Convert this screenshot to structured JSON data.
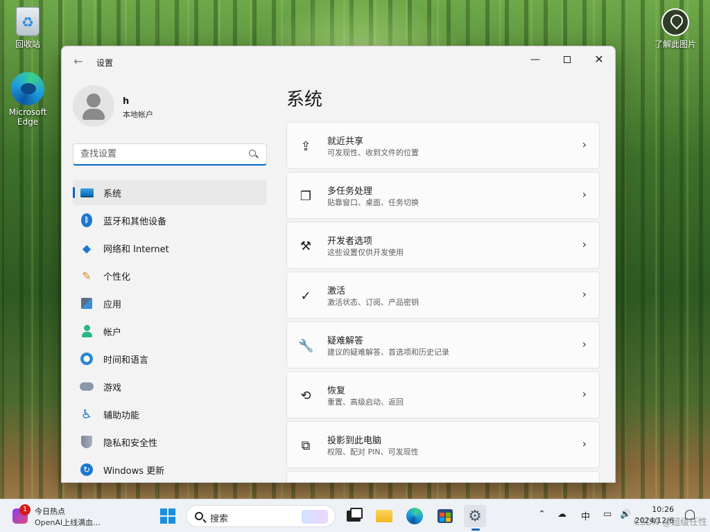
{
  "desktop": {
    "icons": [
      {
        "label": "回收站",
        "icon": "recycle-bin-icon"
      },
      {
        "label": "Microsoft Edge",
        "icon": "edge-icon"
      },
      {
        "label": "了解此图片",
        "icon": "learn-about-picture-icon"
      }
    ]
  },
  "window": {
    "title": "设置",
    "user": {
      "name": "h",
      "account_type": "本地帐户"
    },
    "search": {
      "placeholder": "查找设置"
    },
    "nav": [
      {
        "label": "系统",
        "icon": "system-icon",
        "active": true
      },
      {
        "label": "蓝牙和其他设备",
        "icon": "bluetooth-icon"
      },
      {
        "label": "网络和 Internet",
        "icon": "wifi-icon"
      },
      {
        "label": "个性化",
        "icon": "brush-icon"
      },
      {
        "label": "应用",
        "icon": "apps-icon"
      },
      {
        "label": "帐户",
        "icon": "account-icon"
      },
      {
        "label": "时间和语言",
        "icon": "time-language-icon"
      },
      {
        "label": "游戏",
        "icon": "gamepad-icon"
      },
      {
        "label": "辅助功能",
        "icon": "accessibility-icon"
      },
      {
        "label": "隐私和安全性",
        "icon": "shield-icon"
      },
      {
        "label": "Windows 更新",
        "icon": "update-icon"
      }
    ],
    "page_title": "系统",
    "cards": [
      {
        "title": "就近共享",
        "subtitle": "可发现性、收到文件的位置",
        "icon": "share-icon"
      },
      {
        "title": "多任务处理",
        "subtitle": "贴靠窗口、桌面、任务切换",
        "icon": "multitask-icon"
      },
      {
        "title": "开发者选项",
        "subtitle": "这些设置仅供开发使用",
        "icon": "developer-tools-icon"
      },
      {
        "title": "激活",
        "subtitle": "激活状态、订阅、产品密钥",
        "icon": "check-circle-icon"
      },
      {
        "title": "疑难解答",
        "subtitle": "建议的疑难解答、首选项和历史记录",
        "icon": "wrench-icon"
      },
      {
        "title": "恢复",
        "subtitle": "重置、高级启动、返回",
        "icon": "recovery-icon"
      },
      {
        "title": "投影到此电脑",
        "subtitle": "权限、配对 PIN、可发现性",
        "icon": "project-icon"
      }
    ]
  },
  "taskbar": {
    "news": {
      "badge": "1",
      "title": "今日热点",
      "subtitle": "OpenAI上线满血..."
    },
    "search_label": "搜索",
    "tray": {
      "ime": "中"
    },
    "clock": {
      "time": "10:26",
      "date": "2024/12/6"
    },
    "watermark": "CSDN @超级任性"
  },
  "colors": {
    "accent": "#0067c0",
    "window_bg": "#f3f3f3",
    "card_bg": "#fbfbfb",
    "taskbar_bg": "#eef1f5"
  }
}
